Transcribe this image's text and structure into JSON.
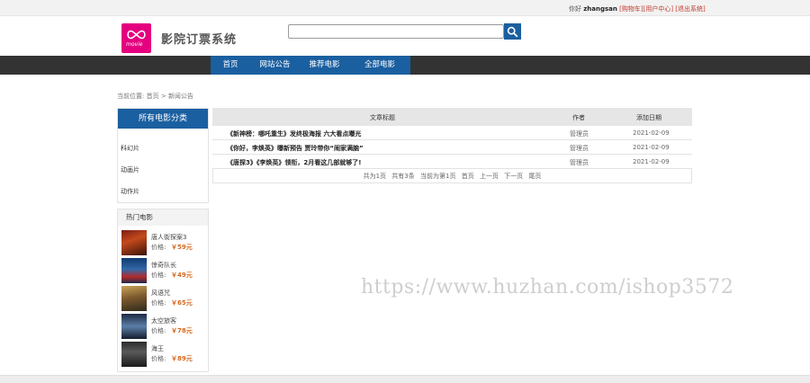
{
  "topbar": {
    "greeting": "你好",
    "username": "zhangsan",
    "cart_link": "[购物车]",
    "user_center_link": "[用户中心]",
    "logout_link": "[退出系统]"
  },
  "header": {
    "logo_text": "movie",
    "site_title": "影院订票系统",
    "search_value": ""
  },
  "nav": {
    "items": [
      "首页",
      "网站公告",
      "推荐电影",
      "全部电影"
    ]
  },
  "breadcrumb": {
    "prefix": "当前位置:",
    "home": "首页",
    "sep": ">",
    "current": "新闻公告"
  },
  "categories": {
    "title": "所有电影分类",
    "items": [
      "科幻片",
      "动画片",
      "动作片"
    ]
  },
  "hot_movies": {
    "title": "热门电影",
    "price_label": "价格:",
    "items": [
      {
        "name": "唐人街探案3",
        "price": "￥59元"
      },
      {
        "name": "惊奇队长",
        "price": "￥49元"
      },
      {
        "name": "风语咒",
        "price": "￥65元"
      },
      {
        "name": "太空旅客",
        "price": "￥78元"
      },
      {
        "name": "海王",
        "price": "￥89元"
      }
    ]
  },
  "articles": {
    "columns": [
      "文章标题",
      "作者",
      "添加日期"
    ],
    "rows": [
      {
        "title": "《新神榜：哪吒重生》发终极海报 六大看点曝光",
        "author": "管理员",
        "date": "2021-02-09"
      },
      {
        "title": "《你好，李焕英》曝新预告 贾玲带你“闹家满脑”",
        "author": "管理员",
        "date": "2021-02-09"
      },
      {
        "title": "《唐探3》《李焕英》领衔，2月看这几部就够了!",
        "author": "管理员",
        "date": "2021-02-09"
      }
    ]
  },
  "pager": {
    "total_pages": "共为1页",
    "total_items": "共有3条",
    "current": "当前为第1页",
    "first": "首页",
    "prev": "上一页",
    "next": "下一页",
    "last": "尾页"
  },
  "watermark": "https://www.huzhan.com/ishop3572",
  "colors": {
    "accent": "#1a5fa0",
    "nav_bg": "#333333",
    "logo": "#e4007f",
    "price": "#d2691e",
    "link_red": "#c0392b"
  }
}
